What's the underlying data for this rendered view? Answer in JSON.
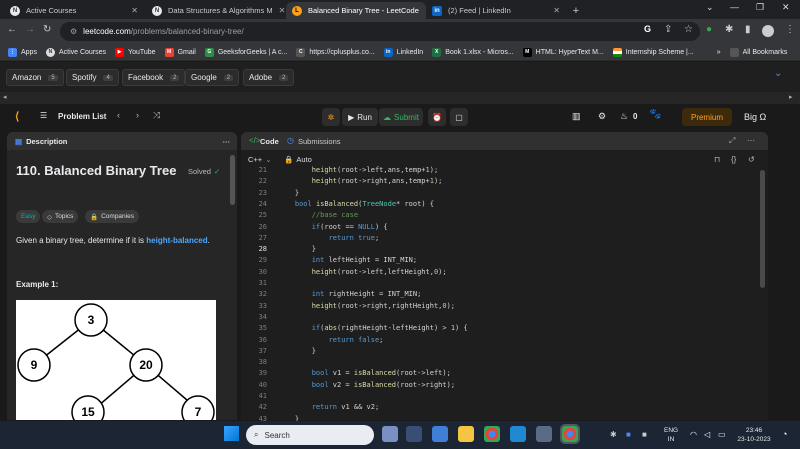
{
  "tabs": [
    {
      "title": "Active Courses",
      "active": false
    },
    {
      "title": "Data Structures & Algorithms M",
      "active": false
    },
    {
      "title": "Balanced Binary Tree - LeetCode",
      "active": true
    },
    {
      "title": "(2) Feed | LinkedIn",
      "active": false
    }
  ],
  "new_tab": "+",
  "address": {
    "host": "leetcode.com",
    "path": "/problems/balanced-binary-tree/"
  },
  "bookmarks": [
    "Apps",
    "Active Courses",
    "YouTube",
    "Gmail",
    "GeeksforGeeks | A c...",
    "https://cplusplus.co...",
    "LinkedIn",
    "Book 1.xlsx - Micros...",
    "HTML: HyperText M...",
    "Internship Scheme |..."
  ],
  "bookmarks_more": "»",
  "all_bookmarks": "All Bookmarks",
  "chips": [
    {
      "label": "Amazon",
      "count": "5"
    },
    {
      "label": "Spotify",
      "count": "4"
    },
    {
      "label": "Facebook",
      "count": "2"
    },
    {
      "label": "Google",
      "count": "2"
    },
    {
      "label": "Adobe",
      "count": "2"
    }
  ],
  "lc": {
    "problem_list": "Problem List",
    "run": "Run",
    "submit": "Submit",
    "streak": "0",
    "premium": "Premium",
    "user": "Big Ω"
  },
  "desc": {
    "tab": "Description",
    "title": "110. Balanced Binary Tree",
    "solved": "Solved",
    "tags": [
      "Easy",
      "Topics",
      "Companies"
    ],
    "text_before": "Given a binary tree, determine if it is ",
    "text_link": "height-balanced",
    "text_after": ".",
    "example": "Example 1:",
    "tree": [
      "3",
      "9",
      "20",
      "15",
      "7"
    ]
  },
  "code": {
    "tab_code": "Code",
    "tab_sub": "Submissions",
    "lang": "C++",
    "auto": "Auto",
    "lines": [
      {
        "n": "21",
        "t": "        height(root->left,ans,temp+1);"
      },
      {
        "n": "22",
        "t": "        height(root->right,ans,temp+1);"
      },
      {
        "n": "23",
        "t": "    }"
      },
      {
        "n": "24",
        "t": "    bool isBalanced(TreeNode* root) {"
      },
      {
        "n": "25",
        "t": "        //base case"
      },
      {
        "n": "26",
        "t": "        if(root == NULL) {"
      },
      {
        "n": "27",
        "t": "            return true;"
      },
      {
        "n": "28",
        "t": "        }"
      },
      {
        "n": "29",
        "t": "        int leftHeight = INT_MIN;"
      },
      {
        "n": "30",
        "t": "        height(root->left,leftHeight,0);"
      },
      {
        "n": "31",
        "t": ""
      },
      {
        "n": "32",
        "t": "        int rightHeight = INT_MIN;"
      },
      {
        "n": "33",
        "t": "        height(root->right,rightHeight,0);"
      },
      {
        "n": "34",
        "t": ""
      },
      {
        "n": "35",
        "t": "        if(abs(rightHeight-leftHeight) > 1) {"
      },
      {
        "n": "36",
        "t": "            return false;"
      },
      {
        "n": "37",
        "t": "        }"
      },
      {
        "n": "38",
        "t": ""
      },
      {
        "n": "39",
        "t": "        bool v1 = isBalanced(root->left);"
      },
      {
        "n": "40",
        "t": "        bool v2 = isBalanced(root->right);"
      },
      {
        "n": "41",
        "t": ""
      },
      {
        "n": "42",
        "t": "        return v1 && v2;"
      },
      {
        "n": "43",
        "t": "    }"
      }
    ]
  },
  "taskbar": {
    "search": "Search",
    "lang1": "ENG",
    "lang2": "IN",
    "time": "23:46",
    "date": "23-10-2023"
  },
  "colors": {
    "accent": "#ffa116",
    "link": "#4ca7ff",
    "run_green": "#2cbb5d"
  }
}
